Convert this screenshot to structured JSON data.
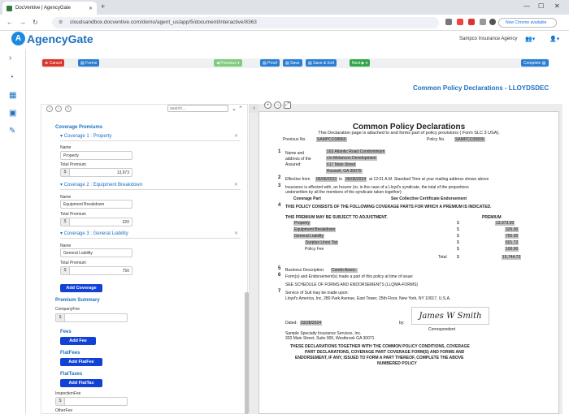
{
  "browser": {
    "tab_title": "DocVentive | AgencyGate",
    "url": "cloudsandbox.docventive.com/demo/agent_us/app/5/document/interactive/8363",
    "new_chrome": "New Chrome available"
  },
  "header": {
    "logo_text": "AgencyGate",
    "agency_name": "Sampco Insurance Agency"
  },
  "toolbar": {
    "cancel": "Cancel",
    "forms": "Forms",
    "previous": "Previous",
    "proof": "Proof",
    "save": "Save",
    "save_exit": "Save & Exit",
    "next": "Next",
    "complete": "Complete"
  },
  "page_title": "Common Policy Declarations - LLOYDSDEC",
  "left": {
    "search_placeholder": "search...",
    "coverage_premiums": "Coverage Premiums",
    "coverages": [
      {
        "header": "Coverage 1 : Property",
        "name_label": "Name",
        "name": "Property",
        "premium_label": "Total Premium",
        "premium": "13,973"
      },
      {
        "header": "Coverage 2 : Equipment Breakdown",
        "name_label": "Name",
        "name": "Equipment Breakdown",
        "premium_label": "Total Premium",
        "premium": "320"
      },
      {
        "header": "Coverage 3 : General Liability",
        "name_label": "Name",
        "name": "General Liability",
        "premium_label": "Total Premium",
        "premium": "750"
      }
    ],
    "add_coverage": "Add Coverage",
    "premium_summary": "Premium Summary",
    "company_fee": "CompanyFee",
    "fees": "Fees",
    "add_fee": "Add Fee",
    "flat_fees": "FlatFees",
    "add_flatfee": "Add FlatFee",
    "flat_taxes": "FlatTaxes",
    "add_flattax": "Add FlatTax",
    "inspection_fee": "InspectionFee",
    "other_fee": "OtherFee",
    "dollar": "$"
  },
  "doc": {
    "title": "Common Policy Declarations",
    "subtitle": "This Declaration page is attached to and forms part of policy provisions ( Form SLC 3 USA).",
    "prev_no_label": "Previous No.",
    "prev_no": "SAMPCO38860",
    "policy_no_label": "Policy No.",
    "policy_no": "SAMPCO35830",
    "item1_label1": "Name and",
    "item1_label2": "address of the",
    "item1_label3": "Assured:",
    "addr1": "163 Atlantic Road Condominium",
    "addr2": "c/o Melancon Development",
    "addr3": "617 Main Street",
    "addr4": "Roswell, GA 30075",
    "item2_a": "Effective from",
    "eff_from": "06/06/2023",
    "item2_to": "to",
    "eff_to": "06/06/2024",
    "item2_b": "at 12:01 A.M. Standard Time at your mailing address shown above",
    "item3_a": "Insurance is effected with, an Insurer (or, in the case of a Lloyd's syndicate, the total of the proportions",
    "item3_b": "underwritten by all the members of the syndicate taken together):",
    "coverage_part": "Coverage Part",
    "see_collective": "See Collective Certificate Endorsement",
    "item4": "THIS POLICY CONSISTS OF THE FOLLOWING COVERAGE PARTS FOR WHICH A PREMIUM IS INDICATED.",
    "subject_adj": "THIS PREMIUM MAY BE SUBJECT TO ADJUSTMENT.",
    "premium_hdr": "PREMIUM",
    "prem_rows": [
      {
        "name": "Property",
        "val": "13,973.00"
      },
      {
        "name": "Equipment Breakdown",
        "val": "320.00"
      },
      {
        "name": "General Liability",
        "val": "750.00"
      },
      {
        "name": "Surplus Lines Tax",
        "val": "601.72"
      },
      {
        "name": "Policy Fee",
        "val": "100.00"
      }
    ],
    "total_label": "Total",
    "total": "15,744.72",
    "dollar": "$",
    "item5_label": "Business Description:",
    "item5_val": "Condo Assoc.",
    "item6": "Form(s) and Endorsement(s) made a part of this policy at time of issue:",
    "item6_b": "SEE SCHEDULE OF FORMS AND ENDORSEMENTS (LLQMA-FORMS)",
    "item7": "Service of Suit may be made upon:",
    "item7_b": "Lloyd's America, Inc, 280 Park Avenue, East Tower, 25th Floor, New York, NY 10017, U.S.A.",
    "dated_label": "Dated:",
    "dated": "03/28/2024",
    "by_label": "by:",
    "signature": "James W Smith",
    "correspondent": "Correspondent",
    "corr_addr1": "Sample Specialty Insurance Services, Inc.",
    "corr_addr2": "320 Main Street, Suite 900, Westbrook GA 30071",
    "closing1": "THESE DECLARATIONS TOGETHER WITH THE COMMON POLICY CONDITIONS, COVERAGE",
    "closing2": "PART DECLARATIONS, COVERAGE PART COVERAGE FORM(S) AND FORMS AND",
    "closing3": "ENDORSEMENT, IF ANY, ISSUED TO FORM A PART THEREOF, COMPLETE THE ABOVE",
    "closing4": "NUMBERED POLICY",
    "n1": "1",
    "n2": "2",
    "n3": "3",
    "n4": "4",
    "n5": "5",
    "n6": "6",
    "n7": "7"
  }
}
